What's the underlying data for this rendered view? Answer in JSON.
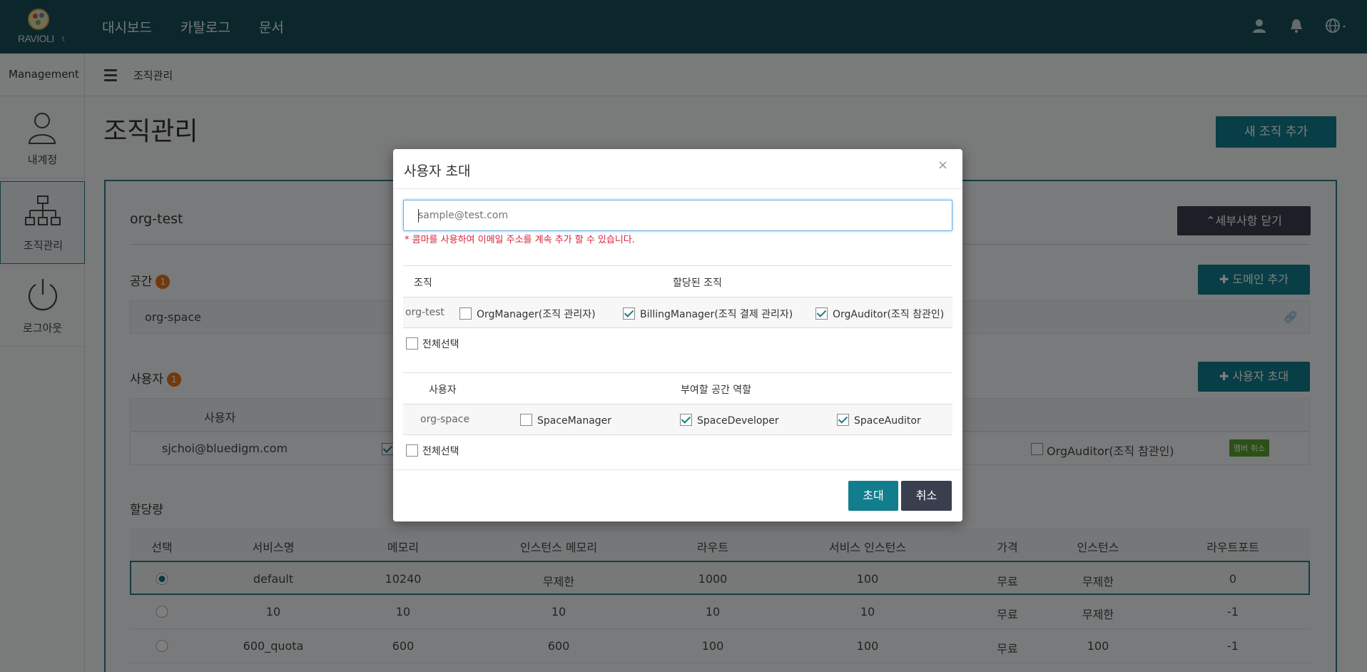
{
  "brand": {
    "name": "RAVIOLI",
    "suffix": "t"
  },
  "nav": {
    "items": [
      "대시보드",
      "카탈로그",
      "문서"
    ]
  },
  "sidebar": {
    "header": "Management",
    "items": [
      {
        "label": "내계정",
        "icon": "user-icon"
      },
      {
        "label": "조직관리",
        "icon": "org-chart-icon"
      },
      {
        "label": "로그아웃",
        "icon": "power-icon"
      }
    ]
  },
  "breadcrumb": {
    "current": "조직관리"
  },
  "page": {
    "title": "조직관리",
    "add_org_button": "새 조직 추가"
  },
  "org": {
    "name": "org-test",
    "close_details_button": "세부사항 닫기",
    "spaces": {
      "title": "공간",
      "count": "1",
      "add_domain_button": "도메인 추가",
      "items": [
        "org-space"
      ]
    },
    "users": {
      "title": "사용자",
      "count": "1",
      "invite_button": "사용자 초대",
      "column_user": "사용자",
      "rows": [
        {
          "email": "sjchoi@bluedigm.com",
          "orgauditor_label": "OrgAuditor(조직 참관인)",
          "cancel_member": "멤버 취소"
        }
      ]
    },
    "quota": {
      "title": "할당량",
      "columns": [
        "선택",
        "서비스명",
        "메모리",
        "인스턴스 메모리",
        "라우트",
        "서비스 인스턴스",
        "가격",
        "인스턴스",
        "라우트포트"
      ],
      "rows": [
        {
          "selected": true,
          "name": "default",
          "memory": "10240",
          "instance_memory": "무제한",
          "routes": "1000",
          "service_instances": "100",
          "price": "무료",
          "instances": "무제한",
          "route_ports": "0"
        },
        {
          "selected": false,
          "name": "10",
          "memory": "10",
          "instance_memory": "10",
          "routes": "10",
          "service_instances": "10",
          "price": "무료",
          "instances": "무제한",
          "route_ports": "-1"
        },
        {
          "selected": false,
          "name": "600_quota",
          "memory": "600",
          "instance_memory": "600",
          "routes": "100",
          "service_instances": "100",
          "price": "무료",
          "instances": "100",
          "route_ports": "-1"
        }
      ]
    }
  },
  "modal": {
    "title": "사용자 초대",
    "close": "×",
    "email_placeholder": "sample@test.com",
    "hint": "* 콤마를 사용하여 이메일 주소를 계속 추가 할 수 있습니다.",
    "org_section": {
      "col_org": "조직",
      "col_assigned": "할당된 조직",
      "row_name": "org-test",
      "roles": [
        {
          "label": "OrgManager(조직 관리자)",
          "checked": false
        },
        {
          "label": "BillingManager(조직 결제 관리자)",
          "checked": true
        },
        {
          "label": "OrgAuditor(조직 참관인)",
          "checked": true
        }
      ],
      "select_all": "전체선택"
    },
    "space_section": {
      "col_user": "사용자",
      "col_roles": "부여할 공간 역할",
      "row_name": "org-space",
      "roles": [
        {
          "label": "SpaceManager",
          "checked": false
        },
        {
          "label": "SpaceDeveloper",
          "checked": true
        },
        {
          "label": "SpaceAuditor",
          "checked": true
        }
      ],
      "select_all": "전체선택"
    },
    "invite_button": "초대",
    "cancel_button": "취소"
  },
  "colors": {
    "topbar": "#164e58",
    "teal": "#117d8d",
    "dark": "#3a3f4f",
    "badge": "#e2731b",
    "hint": "#d9243f"
  }
}
